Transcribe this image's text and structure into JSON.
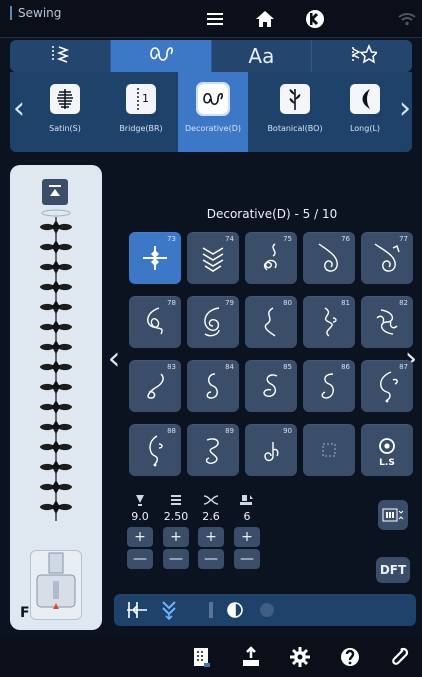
{
  "top_bar": {
    "app_label": "Sewing"
  },
  "mode_tabs": {
    "items": [
      {
        "name": "utility-stitches-tab",
        "icon": "zigzag-stitch-icon"
      },
      {
        "name": "decorative-stitches-tab",
        "icon": "decorative-stitch-icon",
        "active": true
      },
      {
        "name": "alphabet-tab",
        "label": "Aa"
      },
      {
        "name": "favorites-tab",
        "icon": "favorite-stitch-star-icon"
      }
    ]
  },
  "categories": {
    "items": [
      {
        "label": "Satin(S)"
      },
      {
        "label": "Bridge(BR)"
      },
      {
        "label": "Decorative(D)",
        "active": true
      },
      {
        "label": "Botanical(BO)"
      },
      {
        "label": "Long(L)"
      }
    ]
  },
  "grid": {
    "title": "Decorative(D) - 5 / 10",
    "cells": [
      {
        "num": "73",
        "icon": "stitch-73-icon"
      },
      {
        "num": "74",
        "icon": "stitch-74-icon"
      },
      {
        "num": "75",
        "icon": "stitch-75-icon"
      },
      {
        "num": "76",
        "icon": "stitch-76-icon"
      },
      {
        "num": "77",
        "icon": "stitch-77-icon"
      },
      {
        "num": "78",
        "icon": "stitch-78-icon"
      },
      {
        "num": "79",
        "icon": "stitch-79-icon"
      },
      {
        "num": "80",
        "icon": "stitch-80-icon"
      },
      {
        "num": "81",
        "icon": "stitch-81-icon"
      },
      {
        "num": "82",
        "icon": "stitch-82-icon"
      },
      {
        "num": "83",
        "icon": "stitch-83-icon"
      },
      {
        "num": "84",
        "icon": "stitch-84-icon"
      },
      {
        "num": "85",
        "icon": "stitch-85-icon"
      },
      {
        "num": "86",
        "icon": "stitch-86-icon"
      },
      {
        "num": "87",
        "icon": "stitch-87-icon"
      },
      {
        "num": "88",
        "icon": "stitch-88-icon"
      },
      {
        "num": "89",
        "icon": "stitch-89-icon"
      },
      {
        "num": "90",
        "icon": "stitch-90-icon"
      },
      {
        "num": "",
        "icon": "empty-slot-icon"
      },
      {
        "num": "",
        "icon": "ls-icon",
        "label": "L.S"
      }
    ]
  },
  "adjustments": {
    "items": [
      {
        "icon": "stitch-width-icon",
        "value": "9.0",
        "plus_label": "+",
        "minus_label": "—"
      },
      {
        "icon": "stitch-length-icon",
        "value": "2.50",
        "plus_label": "+",
        "minus_label": "—"
      },
      {
        "icon": "tension-icon",
        "value": "2.6",
        "plus_label": "+",
        "minus_label": "—"
      },
      {
        "icon": "presser-foot-pressure-icon",
        "value": "6",
        "plus_label": "+",
        "minus_label": "—"
      }
    ]
  },
  "left_panel": {
    "foot_letter": "F"
  },
  "buttons": {
    "dft_label": "DFT"
  }
}
